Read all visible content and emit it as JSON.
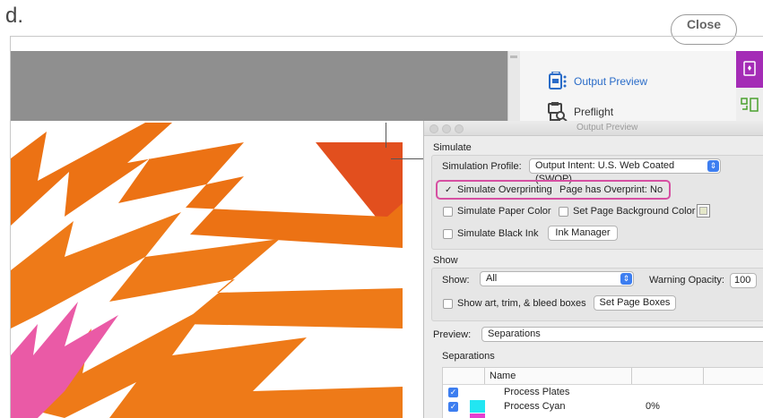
{
  "figure_label": "d.",
  "close_button": "Close",
  "tools_panel": {
    "items": [
      {
        "label": "Output Preview",
        "icon": "output-preview-icon",
        "active": true
      },
      {
        "label": "Preflight",
        "icon": "preflight-icon",
        "active": false
      }
    ],
    "accent_color": "#a42cb6"
  },
  "dialog": {
    "title": "Output Preview",
    "simulate": {
      "heading": "Simulate",
      "profile_label": "Simulation Profile:",
      "profile_value": "Output Intent: U.S. Web Coated (SWOP)...",
      "overprint_label": "Simulate Overprinting",
      "overprint_checked": true,
      "page_has_overprint_label": "Page has Overprint:",
      "page_has_overprint_value": "No",
      "paper_color_label": "Simulate Paper Color",
      "bg_color_label": "Set Page Background Color",
      "black_ink_label": "Simulate Black Ink",
      "ink_manager_label": "Ink Manager"
    },
    "show": {
      "heading": "Show",
      "show_label": "Show:",
      "show_value": "All",
      "warning_label": "Warning Opacity:",
      "warning_value": "100",
      "boxes_label": "Show art, trim, & bleed boxes",
      "set_page_boxes_label": "Set Page Boxes"
    },
    "preview": {
      "label": "Preview:",
      "value": "Separations"
    },
    "separations": {
      "heading": "Separations",
      "column_name": "Name",
      "rows": [
        {
          "name": "Process Plates",
          "percent": "",
          "color": ""
        },
        {
          "name": "Process Cyan",
          "percent": "0%",
          "color": "#22e6f2"
        }
      ]
    }
  },
  "highlight_color": "#d64fa2"
}
